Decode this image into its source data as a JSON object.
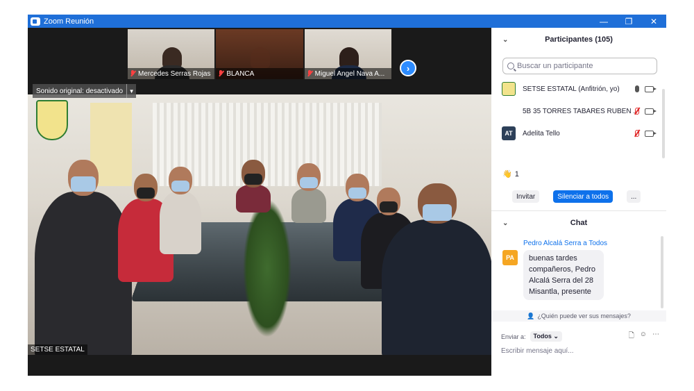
{
  "window": {
    "title": "Zoom Reunión",
    "minimize": "—",
    "restore": "❐",
    "close": "✕"
  },
  "thumbnails": [
    {
      "name": "Mercedes Serras Rojas"
    },
    {
      "name": "BLANCA"
    },
    {
      "name": "Miguel Angel Nava A..."
    }
  ],
  "main_video": {
    "audio_label": "Sonido original: desactivado",
    "speaker_name": "SETSE ESTATAL"
  },
  "participants": {
    "header": "Participantes (105)",
    "search_placeholder": "Buscar un participante",
    "list": [
      {
        "name": "SETSE ESTATAL (Anfitrión, yo)",
        "avatar": "",
        "mic": "on"
      },
      {
        "name": "5B 35 TORRES TABARES RUBEN ...",
        "avatar": "",
        "mic": "muted"
      },
      {
        "name": "Adelita Tello",
        "avatar": "AT",
        "mic": "muted"
      }
    ],
    "reaction_count": "1",
    "invite_label": "Invitar",
    "mute_all_label": "Silenciar a todos",
    "more_label": "..."
  },
  "chat": {
    "header": "Chat",
    "message": {
      "sender": "Pedro Alcalá Serra",
      "to": "a Todos",
      "avatar": "PA",
      "text": "buenas tardes compañeros, Pedro Alcalá Serra del 28 Misantla, presente"
    },
    "who_sees": "¿Quién puede ver sus mensajes?",
    "send_to_label": "Enviar a:",
    "send_to_value": "Todos",
    "input_placeholder": "Escribir mensaje aquí..."
  },
  "colors": {
    "titlebar": "#1f6fd8",
    "primary_button": "#0e71eb",
    "muted_mic": "#e02828"
  }
}
